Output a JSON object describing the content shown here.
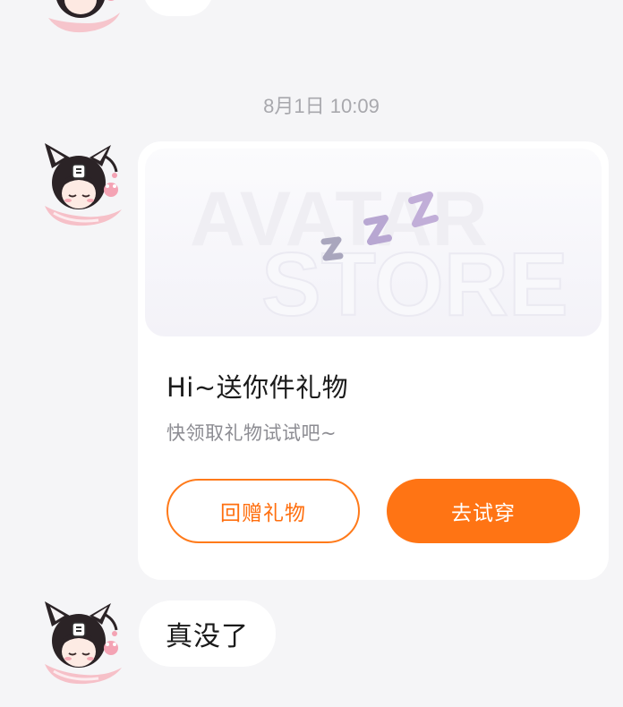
{
  "chat": {
    "timestamp": "8月1日 10:09",
    "gift_card": {
      "banner_text_1": "AVATAR",
      "banner_text_2": "STORE",
      "title": "Hi~送你件礼物",
      "subtitle": "快领取礼物试试吧~",
      "return_gift_label": "回赠礼物",
      "try_on_label": "去试穿"
    },
    "last_message": "真没了"
  },
  "colors": {
    "background": "#f5f5f7",
    "accent": "#ff7414",
    "bubble": "#ffffff",
    "timestamp": "#a8a8ad"
  },
  "icons": {
    "avatar": "anime-cat-girl-avatar",
    "sleep": "zzz-icon"
  }
}
